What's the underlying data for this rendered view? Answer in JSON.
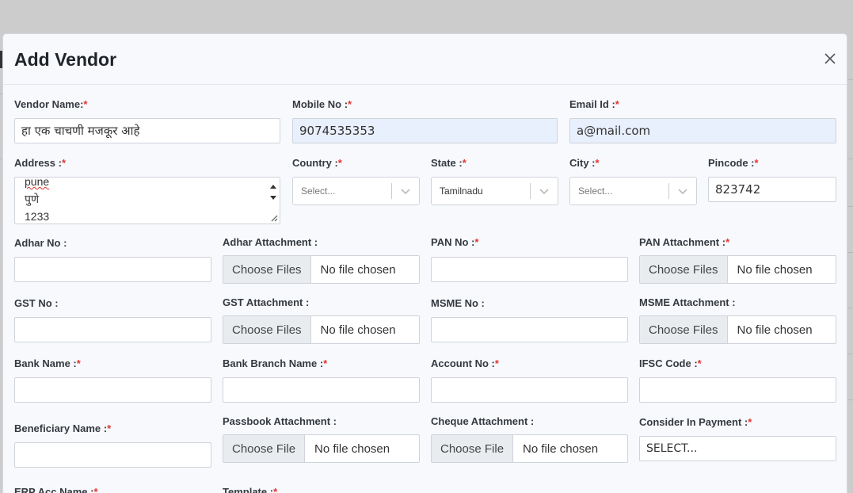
{
  "modal": {
    "title": "Add Vendor"
  },
  "fields": {
    "vendor_name": {
      "label": "Vendor Name:",
      "required": "*",
      "value": "हा एक चाचणी मजकूर आहे"
    },
    "mobile_no": {
      "label": "Mobile No :",
      "required": "*",
      "value": "9074535353"
    },
    "email_id": {
      "label": "Email Id :",
      "required": "*",
      "value": "a@mail.com"
    },
    "address": {
      "label": "Address :",
      "required": "*",
      "lines": [
        "pune",
        "पुणे",
        "1233"
      ]
    },
    "country": {
      "label": "Country :",
      "required": "*",
      "placeholder": "Select..."
    },
    "state": {
      "label": "State :",
      "required": "*",
      "value": "Tamilnadu"
    },
    "city": {
      "label": "City :",
      "required": "*",
      "placeholder": "Select..."
    },
    "pincode": {
      "label": "Pincode :",
      "required": "*",
      "value": "823742"
    },
    "adhar_no": {
      "label": "Adhar No :"
    },
    "adhar_attachment": {
      "label": "Adhar Attachment :",
      "button": "Choose Files",
      "status": "No file chosen"
    },
    "pan_no": {
      "label": "PAN No :",
      "required": "*"
    },
    "pan_attachment": {
      "label": "PAN Attachment :",
      "required": "*",
      "button": "Choose Files",
      "status": "No file chosen"
    },
    "gst_no": {
      "label": "GST No :"
    },
    "gst_attachment": {
      "label": "GST Attachment :",
      "button": "Choose Files",
      "status": "No file chosen"
    },
    "msme_no": {
      "label": "MSME No :"
    },
    "msme_attachment": {
      "label": "MSME Attachment :",
      "button": "Choose Files",
      "status": "No file chosen"
    },
    "bank_name": {
      "label": "Bank Name :",
      "required": "*"
    },
    "bank_branch_name": {
      "label": "Bank Branch Name :",
      "required": "*"
    },
    "account_no": {
      "label": "Account No :",
      "required": "*"
    },
    "ifsc_code": {
      "label": "IFSC Code :",
      "required": "*"
    },
    "beneficiary_name": {
      "label": "Beneficiary Name :",
      "required": "*"
    },
    "passbook_attachment": {
      "label": "Passbook Attachment :",
      "button": "Choose File",
      "status": "No file chosen"
    },
    "cheque_attachment": {
      "label": "Cheque Attachment :",
      "button": "Choose File",
      "status": "No file chosen"
    },
    "consider_in_payment": {
      "label": "Consider In Payment :",
      "required": "*",
      "value": "SELECT..."
    },
    "erp_acc_name": {
      "label": "ERP Acc Name :",
      "required": "*"
    },
    "template": {
      "label": "Template :",
      "required": "*"
    }
  },
  "icons": {
    "close": "close-icon",
    "chevron": "chevron-down-icon"
  }
}
